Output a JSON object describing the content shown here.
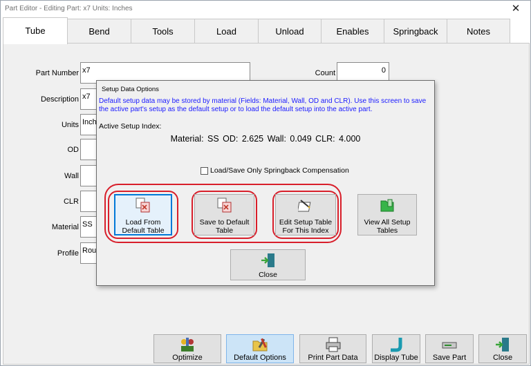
{
  "window": {
    "title": "Part Editor - Editing Part: x7  Units: Inches",
    "close_glyph": "✕"
  },
  "tabs": [
    "Tube",
    "Bend",
    "Tools",
    "Load",
    "Unload",
    "Enables",
    "Springback",
    "Notes"
  ],
  "form": {
    "part_number": {
      "label": "Part Number",
      "value": "x7"
    },
    "description": {
      "label": "Description",
      "value": "x7"
    },
    "units": {
      "label": "Units",
      "value": "Inches"
    },
    "od": {
      "label": "OD",
      "value": ""
    },
    "wall": {
      "label": "Wall",
      "value": ""
    },
    "clr": {
      "label": "CLR",
      "value": ""
    },
    "material": {
      "label": "Material",
      "value": "SS"
    },
    "profile": {
      "label": "Profile",
      "value": "Round"
    },
    "count": {
      "label": "Count",
      "value": "0"
    }
  },
  "dialog": {
    "title": "Setup Data Options",
    "info": "Default setup data may be stored by material (Fields: Material, Wall, OD and CLR).   Use this screen to save the active part's setup as the default setup or to load the default setup into the active part.",
    "index_label": "Active Setup Index:",
    "index_values": "Material: SS   OD: 2.625   Wall: 0.049   CLR: 4.000",
    "checkbox_label": "Load/Save Only Springback Compensation",
    "checkbox_checked": false,
    "buttons": {
      "load_default": "Load From Default Table",
      "save_default": "Save to Default Table",
      "edit_setup": "Edit Setup Table For This Index",
      "view_all": "View All Setup Tables",
      "close": "Close"
    },
    "highlight_color": "#d81e2a"
  },
  "bottom": {
    "optimize": "Optimize",
    "default_options": "Default Options",
    "print_part_data": "Print Part Data",
    "display_tube": "Display Tube",
    "save_part": "Save Part",
    "close": "Close"
  },
  "colors": {
    "tab_active_bg": "#ffffff",
    "panel_bg": "#f0f0f0",
    "focus_blue": "#0078d7",
    "info_text": "#1a1aff"
  }
}
